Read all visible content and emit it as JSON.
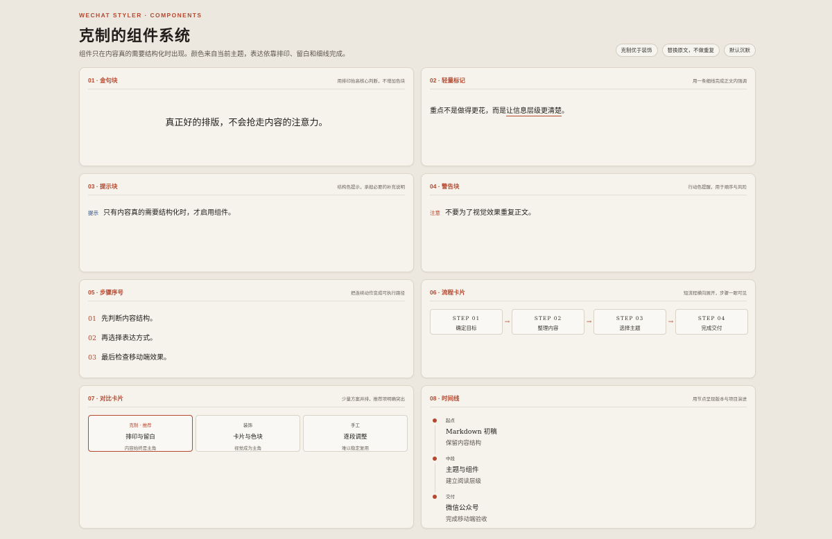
{
  "header": {
    "eyebrow": "WECHAT STYLER · COMPONENTS",
    "title": "克制的组件系统",
    "subtitle": "组件只在内容真的需要结构化时出现。颜色来自当前主题，表达依靠排印、留白和细线完成。",
    "pills": [
      "克制优于装饰",
      "替换原文，不做重复",
      "默认沉默"
    ]
  },
  "cards": {
    "c01": {
      "title": "01 · 金句块",
      "hint": "用排印抬高核心判断，不增加色块",
      "quote": "真正好的排版，不会抢走内容的注意力。"
    },
    "c02": {
      "title": "02 · 轻量标记",
      "hint": "用一条细线完成正文内强调",
      "text_before": "重点不是做得更花，而是",
      "highlight": "让信息层级更清楚",
      "text_after": "。"
    },
    "c03": {
      "title": "03 · 提示块",
      "hint": "结构色提示，承担必要的补充说明",
      "tag": "提示",
      "text": "只有内容真的需要结构化时，才启用组件。"
    },
    "c04": {
      "title": "04 · 警告块",
      "hint": "行动色提醒，用于顺序与风险",
      "tag": "注意",
      "text": "不要为了视觉效果重复正文。"
    },
    "c05": {
      "title": "05 · 步骤序号",
      "hint": "把连续动作变成可执行路径",
      "steps": [
        {
          "num": "01",
          "text": "先判断内容结构。"
        },
        {
          "num": "02",
          "text": "再选择表达方式。"
        },
        {
          "num": "03",
          "text": "最后检查移动端效果。"
        }
      ]
    },
    "c06": {
      "title": "06 · 流程卡片",
      "hint": "短流程横向展开，步骤一眼可见",
      "arrow": "→",
      "steps": [
        {
          "step": "STEP 01",
          "label": "确定目标"
        },
        {
          "step": "STEP 02",
          "label": "整理内容"
        },
        {
          "step": "STEP 03",
          "label": "选择主题"
        },
        {
          "step": "STEP 04",
          "label": "完成交付"
        }
      ]
    },
    "c07": {
      "title": "07 · 对比卡片",
      "hint": "少量方案并排，推荐项明确突出",
      "options": [
        {
          "tag": "克制 · 推荐",
          "title": "排印与留白",
          "sub": "内容始终是主角"
        },
        {
          "tag": "装饰",
          "title": "卡片与色块",
          "sub": "视觉成为主角"
        },
        {
          "tag": "手工",
          "title": "逐段调整",
          "sub": "难以稳定复用"
        }
      ]
    },
    "c08": {
      "title": "08 · 时间线",
      "hint": "用节点呈现版本与项目演进",
      "items": [
        {
          "stage": "起点",
          "title": "Markdown 初稿",
          "sub": "保留内容结构"
        },
        {
          "stage": "中段",
          "title": "主题与组件",
          "sub": "建立阅读层级"
        },
        {
          "stage": "交付",
          "title": "微信公众号",
          "sub": "完成移动端验收"
        }
      ]
    }
  },
  "colors": {
    "accent": "#b5472e",
    "info": "#2d4a7a",
    "background": "#ece8df",
    "card": "#f5f3ec"
  }
}
